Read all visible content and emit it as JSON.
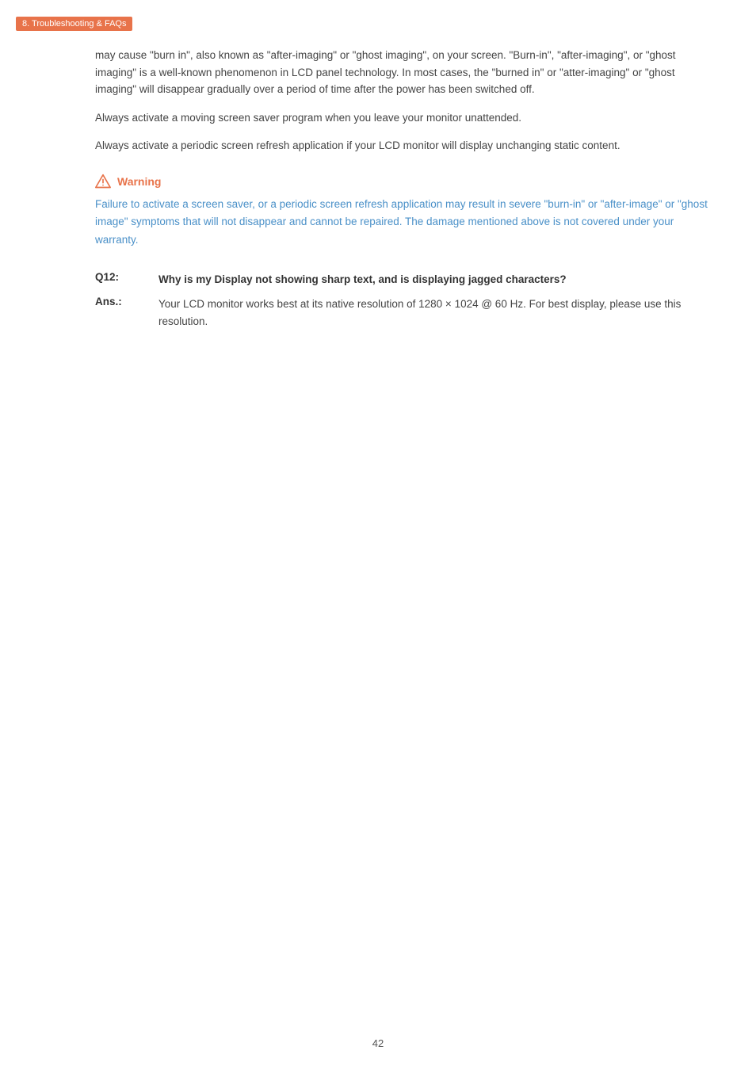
{
  "header": {
    "section": "8. Troubleshooting & FAQs"
  },
  "body_paragraphs": [
    "may cause \"burn in\", also known as \"after-imaging\" or \"ghost imaging\", on your screen. \"Burn-in\", \"after-imaging\", or \"ghost imaging\" is a well-known phenomenon in LCD panel technology. In most cases, the \"burned in\" or \"atter-imaging\" or \"ghost imaging\" will disappear gradually over a period of time after the power has been switched off.",
    "Always activate a moving screen saver program when you leave your monitor unattended.",
    "Always activate a periodic screen refresh application if your LCD monitor will display unchanging static content."
  ],
  "warning": {
    "label": "Warning",
    "icon": "warning-triangle-icon",
    "text": "Failure to activate a screen saver, or a periodic screen refresh application may result in severe \"burn-in\" or \"after-image\" or \"ghost image\" symptoms that will not disappear and cannot be repaired. The damage mentioned above is not covered under your warranty."
  },
  "qa": [
    {
      "id": "Q12",
      "question_label": "Q12:",
      "answer_label": "Ans.:",
      "question": "Why is my Display not showing sharp text, and is displaying jagged characters?",
      "answer": "Your LCD monitor works best at its native resolution of 1280 × 1024 @ 60 Hz. For best display, please use this resolution."
    }
  ],
  "page_number": "42"
}
